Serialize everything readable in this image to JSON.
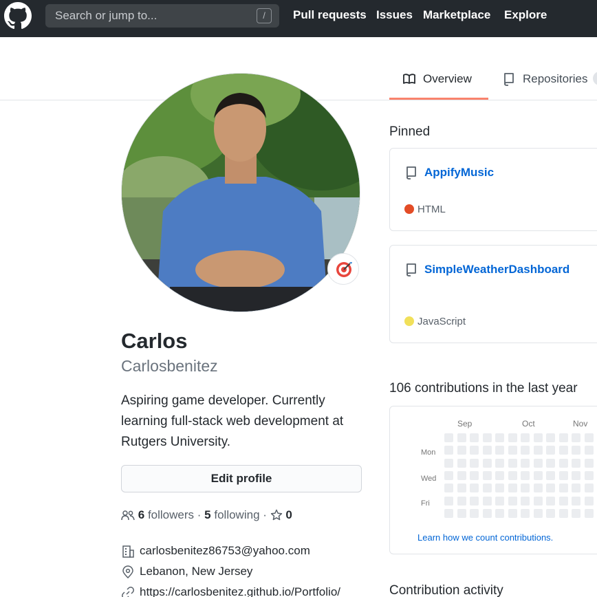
{
  "header": {
    "search_placeholder": "Search or jump to...",
    "search_shortcut": "/",
    "nav": [
      "Pull requests",
      "Issues",
      "Marketplace",
      "Explore"
    ]
  },
  "tabs": {
    "overview": "Overview",
    "repositories": "Repositories"
  },
  "profile": {
    "name": "Carlos",
    "username": "Carlosbenitez",
    "bio": "Aspiring game developer. Currently learning full-stack web development at Rutgers University.",
    "edit_label": "Edit profile",
    "followers_count": "6",
    "followers_label": "followers",
    "following_count": "5",
    "following_label": "following",
    "stars_count": "0",
    "email": "carlosbenitez86753@yahoo.com",
    "location": "Lebanon, New Jersey",
    "website": "https://carlosbenitez.github.io/Portfolio/"
  },
  "pinned": {
    "title": "Pinned",
    "repos": [
      {
        "name": "AppifyMusic",
        "language": "HTML",
        "color": "#e34c26"
      },
      {
        "name": "SimpleWeatherDashboard",
        "language": "JavaScript",
        "color": "#f1e05a"
      }
    ]
  },
  "contributions": {
    "title": "106 contributions in the last year",
    "months": [
      "Sep",
      "Oct",
      "Nov"
    ],
    "days": [
      "Mon",
      "Wed",
      "Fri"
    ],
    "learn_link": "Learn how we count contributions.",
    "empty_color": "#ebedf0"
  },
  "activity": {
    "title": "Contribution activity"
  },
  "colors": {
    "header_bg": "#24292e",
    "accent_tab": "#f9826c",
    "link": "#0366d6"
  }
}
